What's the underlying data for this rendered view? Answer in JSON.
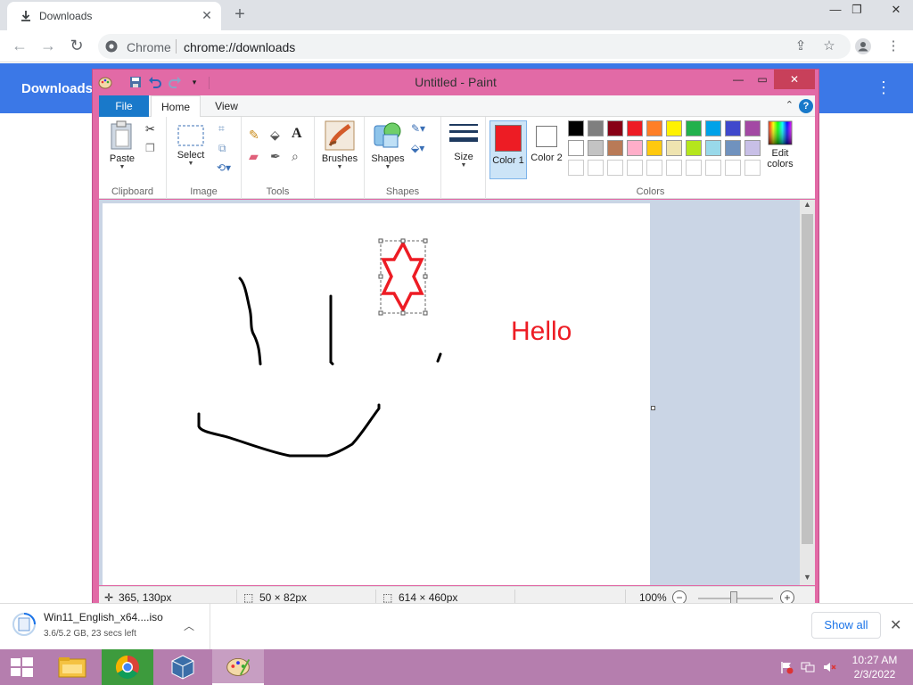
{
  "chrome": {
    "tab_title": "Downloads",
    "site_name": "Chrome",
    "url": "chrome://downloads",
    "page_title": "Downloads"
  },
  "download": {
    "file_name": "Win11_English_x64....iso",
    "status": "3.6/5.2 GB, 23 secs left",
    "show_all": "Show all"
  },
  "paint": {
    "title": "Untitled - Paint",
    "tabs": {
      "file": "File",
      "home": "Home",
      "view": "View"
    },
    "groups": {
      "clipboard": "Clipboard",
      "image": "Image",
      "tools": "Tools",
      "shapes": "Shapes",
      "colors": "Colors"
    },
    "buttons": {
      "paste": "Paste",
      "select": "Select",
      "brushes": "Brushes",
      "shapes": "Shapes",
      "size": "Size",
      "color1_a": "Color",
      "color1_b": "1",
      "color2_a": "Color",
      "color2_b": "2",
      "edit_colors_a": "Edit",
      "edit_colors_b": "colors"
    },
    "palette_row1": [
      "#000000",
      "#7f7f7f",
      "#880015",
      "#ed1c24",
      "#ff7f27",
      "#fff200",
      "#22b14c",
      "#00a2e8",
      "#3f48cc",
      "#a349a4"
    ],
    "palette_row2": [
      "#ffffff",
      "#c3c3c3",
      "#b97a57",
      "#ffaec9",
      "#ffc90e",
      "#efe4b0",
      "#b5e61d",
      "#99d9ea",
      "#7092be",
      "#c8bfe7"
    ],
    "color1": "#ed1c24",
    "color2": "#ffffff",
    "canvas_text": "Hello",
    "status": {
      "cursor": "365, 130px",
      "selection": "50 × 82px",
      "image_size": "614 × 460px",
      "zoom": "100%"
    }
  },
  "taskbar": {
    "time": "10:27 AM",
    "date": "2/3/2022"
  }
}
